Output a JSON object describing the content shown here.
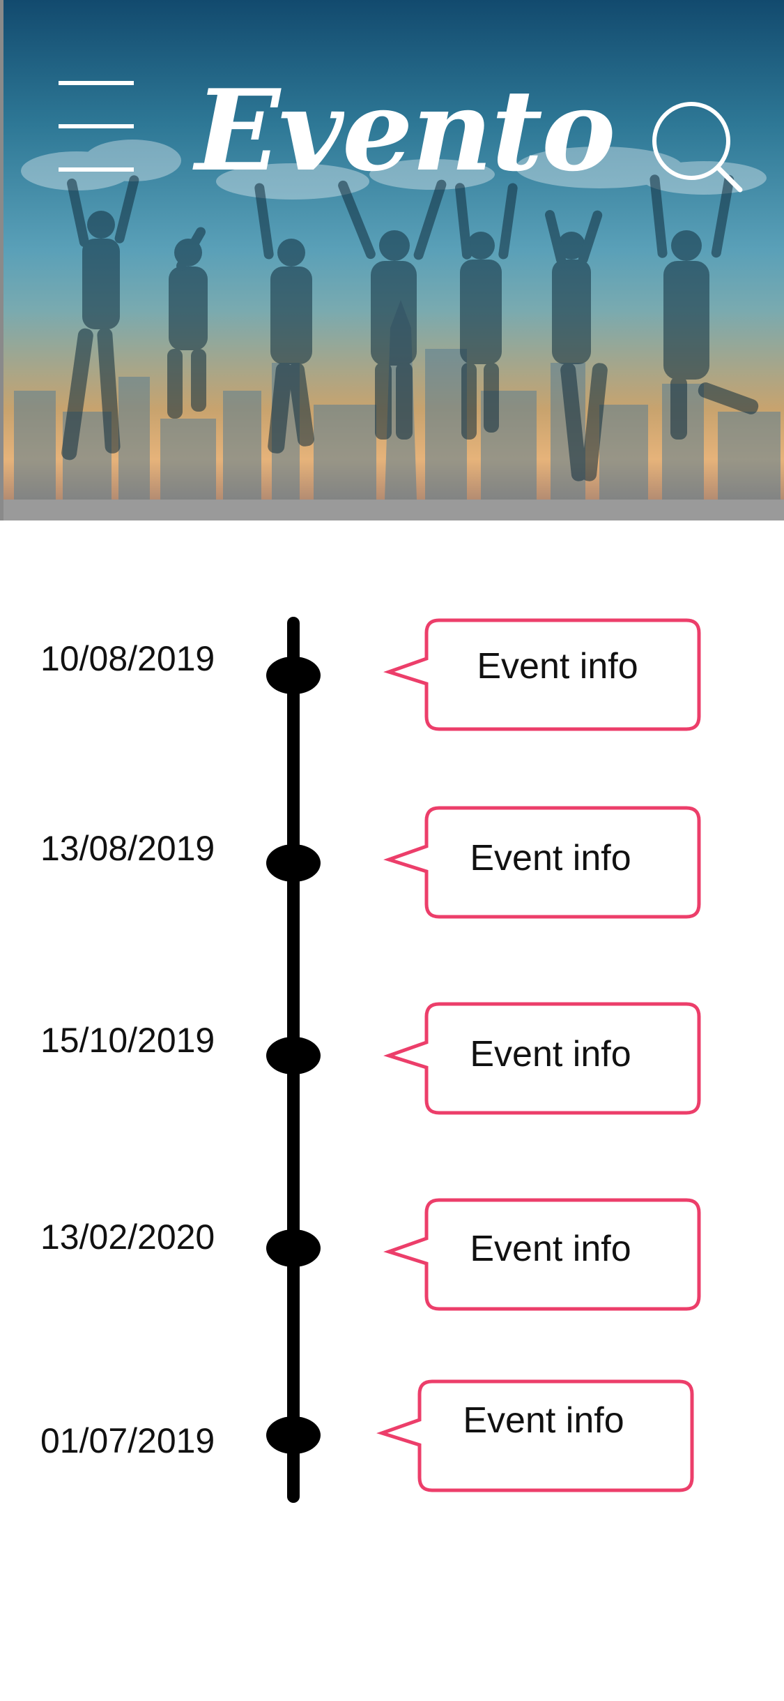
{
  "header": {
    "brand": "Evento",
    "menu_icon": "hamburger-menu-icon",
    "search_icon": "search-icon"
  },
  "colors": {
    "bubble_border": "#ec3e6a",
    "timeline": "#000000",
    "header_bottom_bar": "#9a9a9a"
  },
  "events": [
    {
      "date": "10/08/2019",
      "info": "Event info"
    },
    {
      "date": "13/08/2019",
      "info": "Event info"
    },
    {
      "date": "15/10/2019",
      "info": "Event info"
    },
    {
      "date": "13/02/2020",
      "info": "Event info"
    },
    {
      "date": "01/07/2019",
      "info": "Event info"
    }
  ]
}
